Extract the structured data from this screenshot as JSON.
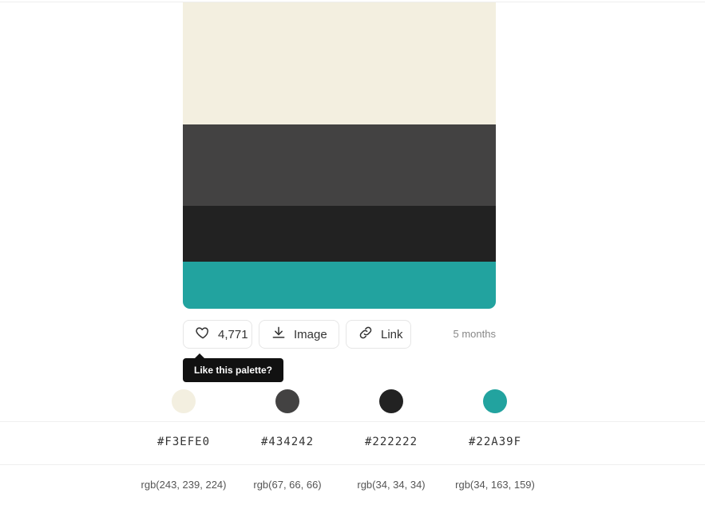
{
  "palette": {
    "colors": [
      {
        "hex": "#F3EFE0",
        "rgb": "rgb(243, 239, 224)",
        "swatch_fraction": 0.399
      },
      {
        "hex": "#434242",
        "rgb": "rgb(67, 66, 66)",
        "swatch_fraction": 0.266
      },
      {
        "hex": "#222222",
        "rgb": "rgb(34, 34, 34)",
        "swatch_fraction": 0.182
      },
      {
        "hex": "#22A39F",
        "rgb": "rgb(34, 163, 159)",
        "swatch_fraction": 0.153
      }
    ]
  },
  "actions": {
    "like_count": "4,771",
    "image_label": "Image",
    "link_label": "Link",
    "age": "5 months",
    "like_icon": "heart-icon",
    "image_icon": "download-icon",
    "link_icon": "link-icon"
  },
  "tooltip": {
    "text": "Like this palette?"
  }
}
